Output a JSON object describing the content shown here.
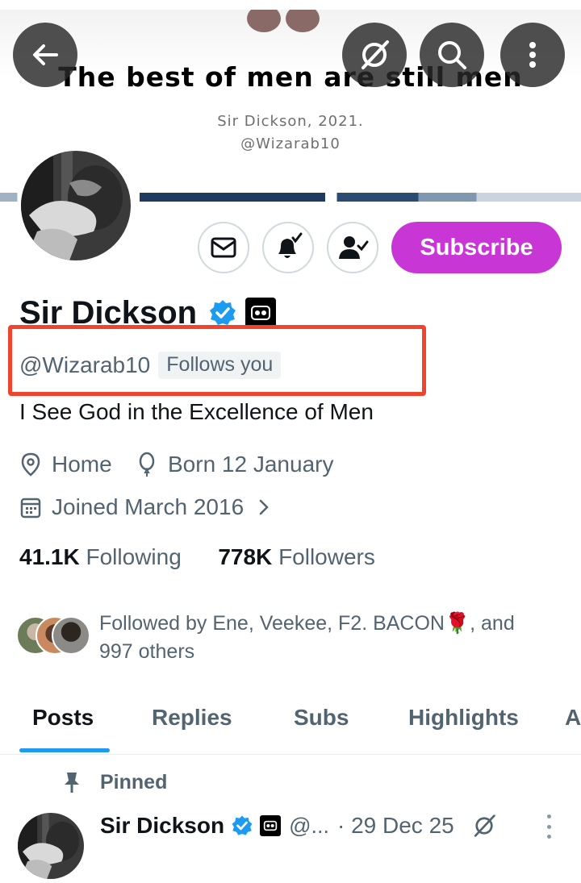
{
  "banner": {
    "quote": "The best of men are still men",
    "credit_line": "Sir Dickson, 2021.",
    "handle_line": "@Wizarab10"
  },
  "top_actions": {
    "back_icon": "arrow-left-icon",
    "grok_icon": "grok-slash-icon",
    "search_icon": "search-icon",
    "more_icon": "more-vertical-icon"
  },
  "profile": {
    "display_name": "Sir Dickson",
    "handle": "@Wizarab10",
    "follows_you": "Follows you",
    "bio": "I See God in the Excellence of Men",
    "location": "Home",
    "birthday": "Born 12 January",
    "joined": "Joined March 2016",
    "following_count": "41.1K",
    "following_label": "Following",
    "followers_count": "778K",
    "followers_label": "Followers",
    "followed_by": "Followed by Ene, Veekee, F2. BACON🌹, and 997 others"
  },
  "actions": {
    "subscribe_label": "Subscribe",
    "message_icon": "mail-icon",
    "notify_icon": "bell-check-icon",
    "following_icon": "person-check-icon"
  },
  "tabs": [
    {
      "label": "Posts",
      "active": true
    },
    {
      "label": "Replies",
      "active": false
    },
    {
      "label": "Subs",
      "active": false
    },
    {
      "label": "Highlights",
      "active": false
    },
    {
      "label": "A",
      "active": false
    }
  ],
  "post": {
    "pinned_label": "Pinned",
    "author": "Sir Dickson",
    "handle": "@...",
    "date": "· 29 Dec 25"
  },
  "colors": {
    "accent": "#1d9bf0",
    "subscribe": "#c936d6",
    "highlight_box": "#f0442e",
    "secondary_text": "#536471"
  }
}
